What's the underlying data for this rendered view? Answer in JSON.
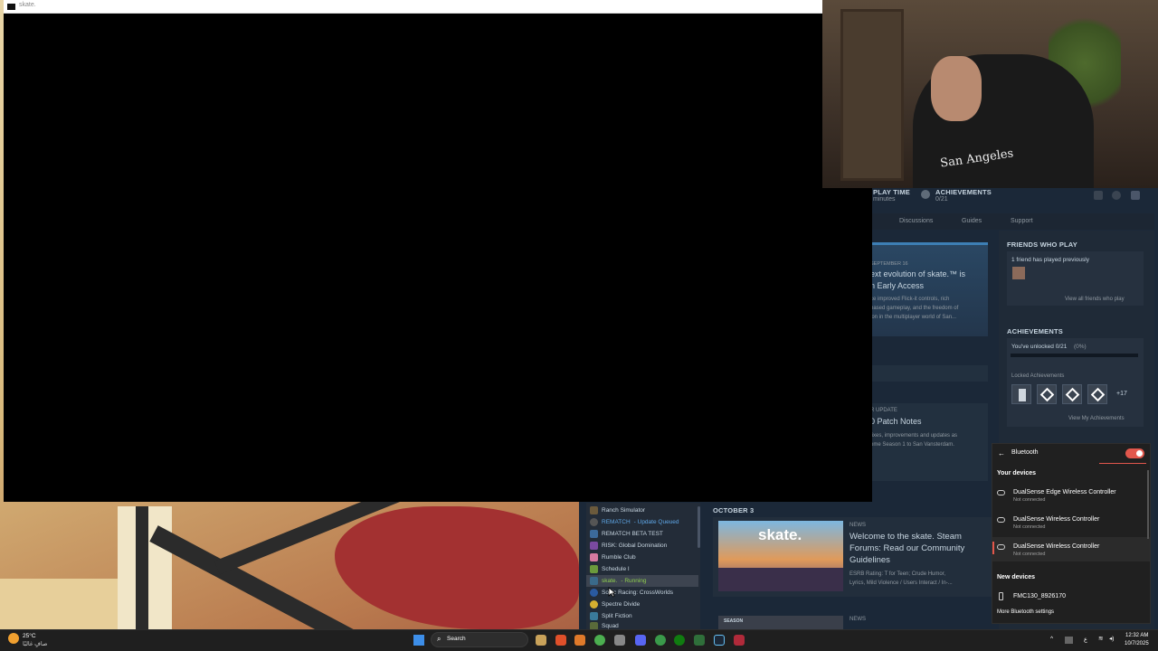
{
  "game_window": {
    "title": "skate."
  },
  "webcam": {
    "shirt_text": "San Angeles"
  },
  "steam": {
    "header": {
      "play_time_label": "PLAY TIME",
      "play_time_value": "minutes",
      "achievements_label": "ACHIEVEMENTS",
      "achievements_value": "0/21"
    },
    "tabs": [
      "Discussions",
      "Guides",
      "Support"
    ],
    "hero": {
      "date": "SEPTEMBER 16",
      "title_line1": "ext evolution of skate.™ is",
      "title_line2": "n Early Access",
      "body_line1": "ce improved Flick-it controls, rich",
      "body_line2": "based gameplay, and the freedom of",
      "body_line3": "ion in the multiplayer world of San..."
    },
    "patch": {
      "kicker": "R UPDATE",
      "title": "0 Patch Notes",
      "body_line1": "fixes, improvements and updates as",
      "body_line2": "ome Season 1 to San Vansterdam."
    },
    "friends": {
      "heading": "FRIENDS WHO PLAY",
      "count_text": "1 friend has played previously",
      "view_all": "View all friends who play"
    },
    "achievements": {
      "heading": "ACHIEVEMENTS",
      "unlocked_text": "You've unlocked 0/21",
      "unlocked_pct": "(0%)",
      "progress": 0,
      "locked_label": "Locked Achievements",
      "more_count": "+17",
      "view_link": "View My Achievements"
    },
    "games": [
      {
        "name": "Ranch Simulator",
        "status": ""
      },
      {
        "name": "REMATCH",
        "status": " - Update Queued",
        "status_kind": "blue"
      },
      {
        "name": "REMATCH BETA TEST",
        "status": ""
      },
      {
        "name": "RISK: Global Domination",
        "status": ""
      },
      {
        "name": "Rumble Club",
        "status": ""
      },
      {
        "name": "Schedule I",
        "status": ""
      },
      {
        "name": "skate.",
        "status": " - Running",
        "status_kind": "green",
        "selected": true
      },
      {
        "name": "Sonic Racing: CrossWorlds",
        "status": ""
      },
      {
        "name": "Spectre Divide",
        "status": ""
      },
      {
        "name": "Split Fiction",
        "status": ""
      },
      {
        "name": "Squad",
        "status": ""
      }
    ],
    "news": {
      "date_label": "OCTOBER 3",
      "kicker": "NEWS",
      "thumb_logo": "skate.",
      "title_line1": "Welcome to the skate. Steam",
      "title_line2": "Forums: Read our Community",
      "title_line3": "Guidelines",
      "body_line1": "ESRB Rating: T for Teen; Crude Humor,",
      "body_line2": "Lyrics, Mild Violence / Users Interact / In-...",
      "kicker2": "NEWS",
      "thumb2_label": "SEASON"
    }
  },
  "bluetooth": {
    "title": "Bluetooth",
    "enabled": true,
    "your_devices_label": "Your devices",
    "devices": [
      {
        "name": "DualSense Edge Wireless Controller",
        "status": "Not connected"
      },
      {
        "name": "DualSense Wireless Controller",
        "status": "Not connected"
      },
      {
        "name": "DualSense Wireless Controller",
        "status": "Not connected"
      }
    ],
    "new_devices_label": "New devices",
    "new_device": "FMC130_8926170",
    "more_settings": "More Bluetooth settings"
  },
  "taskbar": {
    "weather_temp": "25°C",
    "weather_desc": "صافٍ غالبًا",
    "search_placeholder": "Search",
    "time": "12:32 AM",
    "date": "10/7/2025",
    "lang": "ع"
  }
}
